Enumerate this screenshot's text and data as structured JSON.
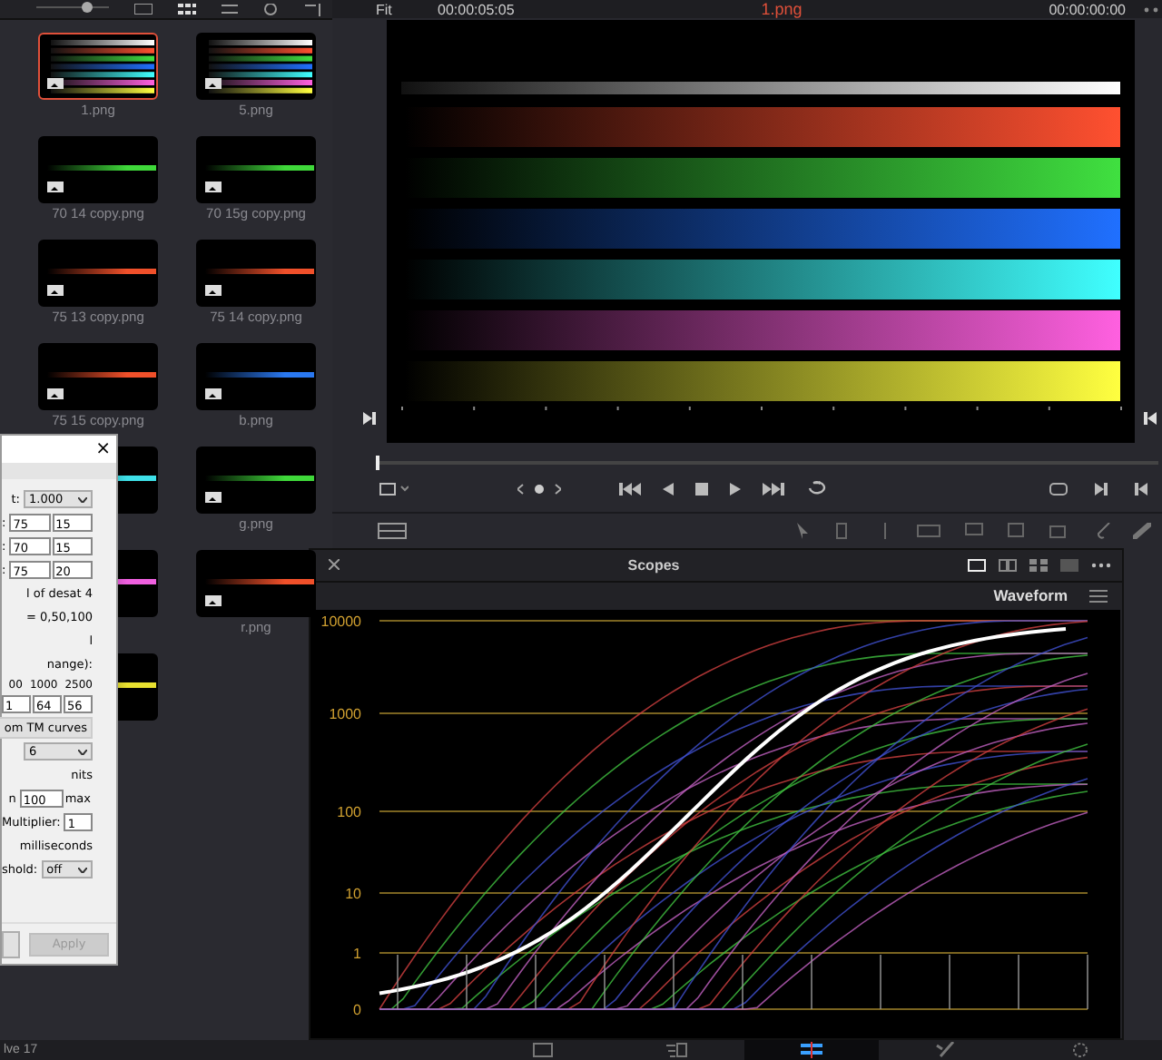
{
  "clips": [
    {
      "label": "1.png",
      "kind": "bars",
      "selected": true
    },
    {
      "label": "5.png",
      "kind": "bars",
      "selected": false
    },
    {
      "label": "70 14 copy.png",
      "kind": "line",
      "color": "#3fd83a",
      "selected": false
    },
    {
      "label": "70 15g copy.png",
      "kind": "line",
      "color": "#3fd83a",
      "selected": false
    },
    {
      "label": "75 13 copy.png",
      "kind": "line",
      "color": "#f0502a",
      "selected": false
    },
    {
      "label": "75 14 copy.png",
      "kind": "line",
      "color": "#f0502a",
      "selected": false
    },
    {
      "label": "75 15 copy.png",
      "kind": "line",
      "color": "#f0502a",
      "selected": false
    },
    {
      "label": "b.png",
      "kind": "line",
      "color": "#2a78f0",
      "selected": false
    },
    {
      "kind": "line",
      "color": "#3ee0e8",
      "selected": false
    },
    {
      "label": "g.png",
      "kind": "line",
      "color": "#3fd83a",
      "selected": false
    },
    {
      "kind": "line",
      "color": "#f060e0",
      "selected": false
    },
    {
      "label": "r.png",
      "kind": "line",
      "color": "#f0502a",
      "selected": false
    },
    {
      "kind": "line",
      "color": "#e8e030",
      "selected": false
    }
  ],
  "viewer": {
    "zoom": "Fit",
    "duration": "00:00:05:05",
    "clip_title": "1.png",
    "timecode": "00:00:00:00",
    "playhead": {
      "level": 0
    }
  },
  "scopes": {
    "title": "Scopes",
    "scope_type": "Waveform",
    "y_labels": [
      "10000",
      "1000",
      "100",
      "10",
      "1",
      "0"
    ]
  },
  "dialog": {
    "close": "×",
    "rows": [
      {
        "kind": "select",
        "label": "t:",
        "value": "1.000"
      },
      {
        "kind": "pair",
        "label": ":",
        "values": [
          "75",
          "15"
        ]
      },
      {
        "kind": "pair",
        "label": ":",
        "values": [
          "70",
          "15"
        ]
      },
      {
        "kind": "pair",
        "label": ":",
        "values": [
          "75",
          "20"
        ]
      },
      {
        "kind": "text",
        "text": "l of desat 4"
      },
      {
        "kind": "text",
        "text": "= 0,50,100"
      },
      {
        "kind": "text",
        "text": "l"
      },
      {
        "kind": "text",
        "text": "nange):"
      },
      {
        "kind": "heads",
        "values": [
          "00",
          "1000",
          "2500"
        ]
      },
      {
        "kind": "triple",
        "values": [
          "1",
          "64",
          "56"
        ]
      },
      {
        "kind": "button",
        "text": "om TM curves"
      },
      {
        "kind": "select",
        "value": "6"
      },
      {
        "kind": "text",
        "text": "nits"
      },
      {
        "kind": "field",
        "label": "n",
        "value": "100",
        "suffix": "max"
      },
      {
        "kind": "field",
        "label": "Multiplier:",
        "value": "1"
      },
      {
        "kind": "text",
        "text": "milliseconds"
      },
      {
        "kind": "select",
        "label": "shold:",
        "value": "off"
      }
    ],
    "apply": {
      "text": "Apply",
      "disabled": true
    }
  },
  "pages": [
    {
      "kind": "edit",
      "selected": false
    },
    {
      "kind": "fusion",
      "selected": false
    },
    {
      "kind": "color",
      "selected": true
    },
    {
      "kind": "fairlight",
      "selected": false
    },
    {
      "kind": "deliver",
      "selected": false
    }
  ],
  "status": "lve 17"
}
